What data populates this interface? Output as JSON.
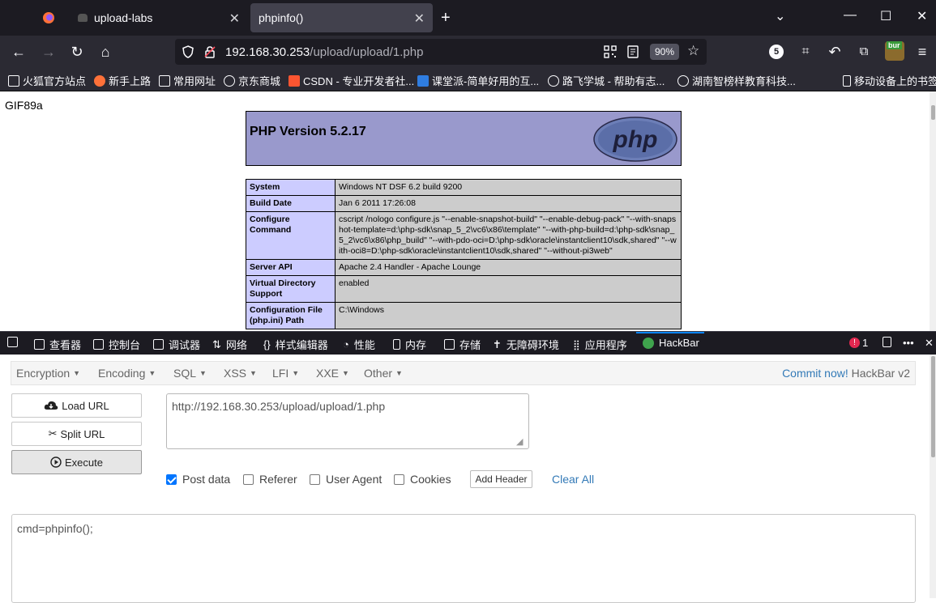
{
  "browser": {
    "tabs": [
      {
        "label": "upload-labs"
      },
      {
        "label": "phpinfo()"
      }
    ],
    "url_host": "192.168.30.253",
    "url_path": "/upload/upload/1.php",
    "zoom": "90%",
    "notification_count": "5"
  },
  "bookmarks": [
    {
      "label": "火狐官方站点"
    },
    {
      "label": "新手上路"
    },
    {
      "label": "常用网址"
    },
    {
      "label": "京东商城"
    },
    {
      "label": "CSDN - 专业开发者社..."
    },
    {
      "label": "课堂派-简单好用的互..."
    },
    {
      "label": "路飞学城 - 帮助有志..."
    },
    {
      "label": "湖南智榜样教育科技..."
    },
    {
      "label": "移动设备上的书签"
    }
  ],
  "page": {
    "gif_header": "GIF89a",
    "php_version": "PHP Version 5.2.17",
    "logo_text": "php",
    "rows": [
      {
        "key": "System",
        "value": "Windows NT DSF 6.2 build 9200"
      },
      {
        "key": "Build Date",
        "value": "Jan 6 2011 17:26:08"
      },
      {
        "key": "Configure Command",
        "value": "cscript /nologo configure.js \"--enable-snapshot-build\" \"--enable-debug-pack\" \"--with-snapshot-template=d:\\php-sdk\\snap_5_2\\vc6\\x86\\template\" \"--with-php-build=d:\\php-sdk\\snap_5_2\\vc6\\x86\\php_build\" \"--with-pdo-oci=D:\\php-sdk\\oracle\\instantclient10\\sdk,shared\" \"--with-oci8=D:\\php-sdk\\oracle\\instantclient10\\sdk,shared\" \"--without-pi3web\""
      },
      {
        "key": "Server API",
        "value": "Apache 2.4 Handler - Apache Lounge"
      },
      {
        "key": "Virtual Directory Support",
        "value": "enabled"
      },
      {
        "key": "Configuration File (php.ini) Path",
        "value": "C:\\Windows"
      }
    ]
  },
  "devtools": {
    "tabs": [
      {
        "label": "查看器"
      },
      {
        "label": "控制台"
      },
      {
        "label": "调试器"
      },
      {
        "label": "网络"
      },
      {
        "label": "样式编辑器"
      },
      {
        "label": "性能"
      },
      {
        "label": "内存"
      },
      {
        "label": "存储"
      },
      {
        "label": "无障碍环境"
      },
      {
        "label": "应用程序"
      },
      {
        "label": "HackBar"
      }
    ],
    "error_count": "1"
  },
  "hackbar": {
    "menus": [
      {
        "label": "Encryption"
      },
      {
        "label": "Encoding"
      },
      {
        "label": "SQL"
      },
      {
        "label": "XSS"
      },
      {
        "label": "LFI"
      },
      {
        "label": "XXE"
      },
      {
        "label": "Other"
      }
    ],
    "commit_label": "Commit now!",
    "version_label": "HackBar v2",
    "load_url": "Load URL",
    "split_url": "Split URL",
    "execute": "Execute",
    "url_value": "http://192.168.30.253/upload/upload/1.php",
    "options": {
      "post_data": "Post data",
      "referer": "Referer",
      "user_agent": "User Agent",
      "cookies": "Cookies"
    },
    "post_data_checked": true,
    "add_header": "Add Header",
    "clear_all": "Clear All",
    "post_value": "cmd=phpinfo();"
  },
  "colors": {
    "php_header_bg": "#9999cc",
    "php_key_bg": "#ccccff",
    "php_value_bg": "#cccccc",
    "link_blue": "#337ab7",
    "browser_dark": "#1c1b22"
  }
}
